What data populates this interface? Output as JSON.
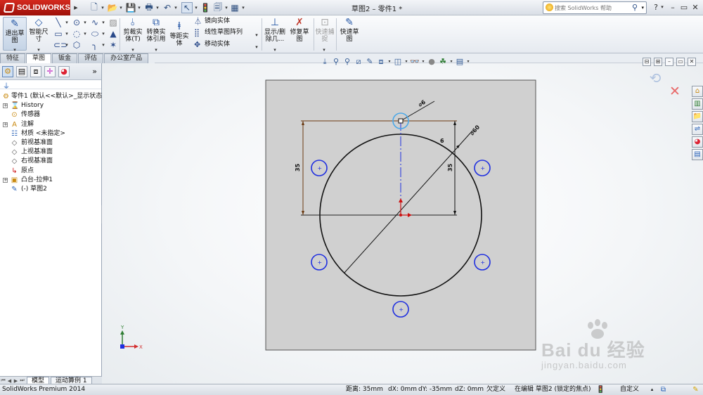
{
  "titlebar": {
    "brand": "SOLIDWORKS",
    "document_title": "草图2 – 零件1 *",
    "search_placeholder": "搜索 SolidWorks 帮助",
    "help_label": "?",
    "minimize": "–",
    "restore": "▭",
    "close": "✕"
  },
  "ribbon": {
    "exit_sketch": "退出草\n图",
    "smart_dimension": "智能尺\n寸",
    "trim_entities": "剪裁实\n体(T)",
    "convert_entities": "转换实\n体引用",
    "offset_entities": "等距实\n体",
    "mirror_entities": "镜向实体",
    "linear_pattern": "线性草图阵列",
    "move_entities": "移动实体",
    "display_delete_relations": "显示/删\n除几...",
    "repair_sketch": "修复草\n图",
    "quick_snaps": "快速捕\n捉",
    "rapid_sketch": "快速草\n图"
  },
  "tabs": [
    "特征",
    "草图",
    "钣金",
    "评估",
    "办公室产品"
  ],
  "active_tab": "草图",
  "feature_tree": {
    "root": "零件1 (默认<<默认>_显示状态",
    "items": [
      {
        "label": "History",
        "icon": "history-icon",
        "expandable": true
      },
      {
        "label": "传感器",
        "icon": "sensor-icon",
        "expandable": false
      },
      {
        "label": "注解",
        "icon": "annotation-icon",
        "expandable": true
      },
      {
        "label": "材质 <未指定>",
        "icon": "material-icon",
        "expandable": false
      },
      {
        "label": "前视基准面",
        "icon": "plane-icon",
        "expandable": false
      },
      {
        "label": "上视基准面",
        "icon": "plane-icon",
        "expandable": false
      },
      {
        "label": "右视基准面",
        "icon": "plane-icon",
        "expandable": false
      },
      {
        "label": "原点",
        "icon": "origin-icon",
        "expandable": false
      },
      {
        "label": "凸台-拉伸1",
        "icon": "extrude-icon",
        "expandable": true
      },
      {
        "label": "(-) 草图2",
        "icon": "sketch-icon",
        "expandable": false
      }
    ]
  },
  "bottom_tabs": [
    "模型",
    "运动算例 1"
  ],
  "sketch": {
    "dim_hole_dia": "⌀6",
    "dim_circle_dia": "⌀60",
    "dim_left_height": "35",
    "dim_right_height": "35",
    "dim_small": "6"
  },
  "triad": {
    "x": "X",
    "y": "Y"
  },
  "watermark": {
    "main": "Bai du 经验",
    "sub": "jingyan.baidu.com"
  },
  "statusbar": {
    "product": "SolidWorks Premium 2014",
    "distance": "距离: 35mm",
    "dx": "dX: 0mm",
    "dy": "dY: -35mm",
    "dz": "dZ: 0mm",
    "definition": "欠定义",
    "editing": "在编辑 草图2 (锁定的焦点)",
    "units": "自定义"
  },
  "colors": {
    "sketch_blue": "#1f2fe0",
    "highlight_blue": "#4aa8e8",
    "dimension_brown": "#6b3a12",
    "plate_gray": "#d0d0d0",
    "brand_red": "#c41e14"
  }
}
